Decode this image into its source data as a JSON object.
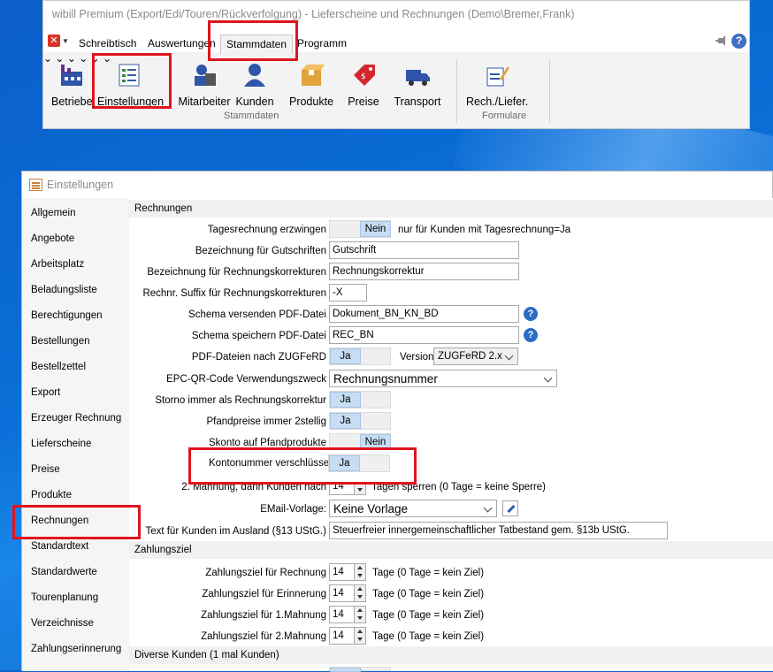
{
  "window": {
    "title": "wibill Premium (Export/Edi/Touren/Rückverfolgung) - Lieferscheine und Rechnungen (Demo\\Bremer,Frank)"
  },
  "menu": {
    "tabs": [
      "Schreibtisch",
      "Auswertungen",
      "Stammdaten",
      "Programm"
    ],
    "active_tab": "Stammdaten"
  },
  "ribbon": {
    "buttons": [
      "Betriebe",
      "Einstellungen",
      "Mitarbeiter",
      "Kunden",
      "Produkte",
      "Preise",
      "Transport",
      "Rech./Liefer."
    ],
    "groups": [
      "Stammdaten",
      "Formulare"
    ]
  },
  "settings": {
    "title": "Einstellungen",
    "nav": [
      "Allgemein",
      "Angebote",
      "Arbeitsplatz",
      "Beladungsliste",
      "Berechtigungen",
      "Bestellungen",
      "Bestellzettel",
      "Export",
      "Erzeuger Rechnung",
      "Lieferscheine",
      "Preise",
      "Produkte",
      "Rechnungen",
      "Standardtext",
      "Standardwerte",
      "Tourenplanung",
      "Verzeichnisse",
      "Zahlungserinnerung"
    ],
    "nav_selected": "Rechnungen"
  },
  "rechnungen": {
    "section": "Rechnungen",
    "tagesrechnung": {
      "label": "Tagesrechnung erzwingen",
      "value": "Nein",
      "note": "nur für Kunden mit Tagesrechnung=Ja"
    },
    "gutschriften": {
      "label": "Bezeichnung für Gutschriften",
      "value": "Gutschrift"
    },
    "korrekturen": {
      "label": "Bezeichnung für Rechnungskorrekturen",
      "value": "Rechnungskorrektur"
    },
    "suffix": {
      "label": "Rechnr. Suffix für Rechnungskorrekturen",
      "value": "-X"
    },
    "schema_versenden": {
      "label": "Schema versenden PDF-Datei",
      "value": "Dokument_BN_KN_BD"
    },
    "schema_speichern": {
      "label": "Schema speichern PDF-Datei",
      "value": "REC_BN"
    },
    "zugferd": {
      "label": "PDF-Dateien nach ZUGFeRD",
      "value": "Ja",
      "version_label": "Version",
      "version_value": "ZUGFeRD 2.x"
    },
    "epc": {
      "label": "EPC-QR-Code Verwendungszweck",
      "value": "Rechnungsnummer"
    },
    "storno": {
      "label": "Storno immer als Rechnungskorrektur",
      "value": "Ja"
    },
    "pfandpreise": {
      "label": "Pfandpreise immer 2stellig",
      "value": "Ja"
    },
    "skonto": {
      "label": "Skonto auf Pfandprodukte",
      "value": "Nein"
    },
    "kontonummer": {
      "label": "Kontonummer verschlüsseln",
      "value": "Ja"
    },
    "mahnung": {
      "label": "2. Mahnung, dann Kunden nach",
      "value": "14",
      "note": "Tagen sperren (0 Tage = keine Sperre)"
    },
    "email": {
      "label": "EMail-Vorlage:",
      "value": "Keine Vorlage"
    },
    "ausland": {
      "label": "Text für Kunden im Ausland (§13 UStG.)",
      "value": "Steuerfreier innergemeinschaftlicher Tatbestand gem. §13b UStG."
    }
  },
  "zahlungsziel": {
    "section": "Zahlungsziel",
    "rows": [
      {
        "label": "Zahlungsziel für Rechnung",
        "value": "14",
        "note": "Tage (0 Tage = kein Ziel)"
      },
      {
        "label": "Zahlungsziel für Erinnerung",
        "value": "14",
        "note": "Tage (0 Tage = kein Ziel)"
      },
      {
        "label": "Zahlungsziel für 1.Mahnung",
        "value": "14",
        "note": "Tage (0 Tage = kein Ziel)"
      },
      {
        "label": "Zahlungsziel für 2.Mahnung",
        "value": "14",
        "note": "Tage (0 Tage = kein Ziel)"
      }
    ]
  },
  "diverse": {
    "section": "Diverse Kunden (1 mal Kunden)"
  },
  "icons": {
    "help": "?"
  }
}
